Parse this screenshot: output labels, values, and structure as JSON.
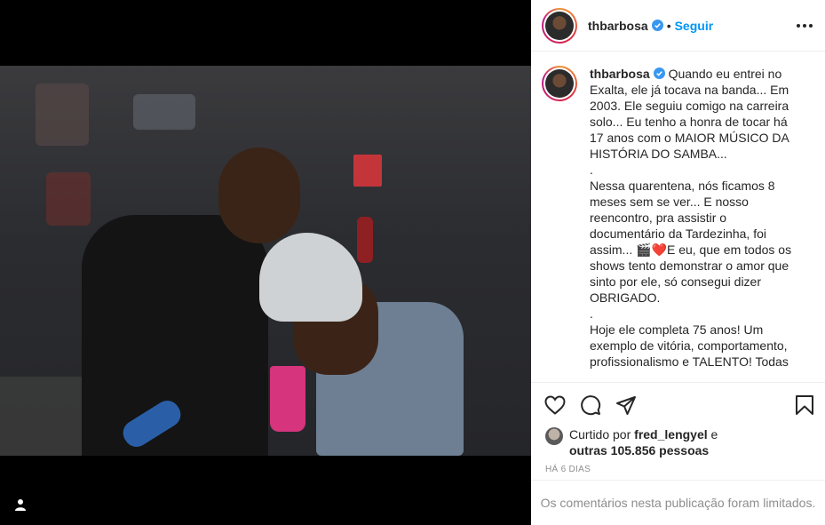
{
  "header": {
    "username": "thbarbosa",
    "verified": true,
    "separator": "•",
    "follow_label": "Seguir",
    "more_icon": "more-horizontal-icon"
  },
  "caption": {
    "username": "thbarbosa",
    "text": " Quando eu entrei no Exalta, ele já tocava na banda... Em 2003. Ele seguiu comigo na carreira solo... Eu tenho a honra de tocar há 17 anos com o MAIOR MÚSICO DA HISTÓRIA DO SAMBA...\n.\nNessa quarentena, nós ficamos 8 meses sem se ver... E nosso reencontro, pra assistir o documentário da Tardezinha, foi assim... 🎬❤️E eu, que em todos os shows tento demonstrar o amor que sinto por ele, só consegui dizer OBRIGADO.\n.\nHoje ele completa 75 anos! Um exemplo de vitória, comportamento, profissionalismo e TALENTO! Todas"
  },
  "actions": {
    "like_icon": "heart-icon",
    "comment_icon": "comment-icon",
    "share_icon": "share-icon",
    "save_icon": "bookmark-icon"
  },
  "likes": {
    "prefix": "Curtido por ",
    "liker": "fred_lengyel",
    "middle": " e ",
    "others": "outras 105.856 pessoas"
  },
  "timestamp": "HÁ 6 DIAS",
  "comments_limited": "Os comentários nesta publicação foram limitados.",
  "colors": {
    "accent": "#0095f6",
    "text": "#262626",
    "muted": "#8e8e8e",
    "border": "#efefef"
  }
}
